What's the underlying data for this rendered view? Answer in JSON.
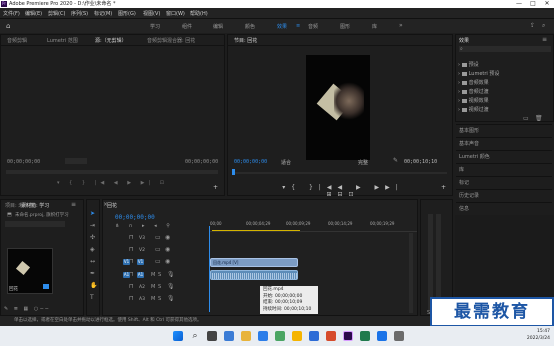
{
  "window": {
    "title": "Adobe Premiere Pro 2020 - D:\\作业\\未命名 *",
    "app_badge": "Pr",
    "controls": [
      "—",
      "□",
      "✕"
    ]
  },
  "menubar": [
    "文件(F)",
    "编辑(E)",
    "剪辑(C)",
    "序列(S)",
    "标记(M)",
    "图形(G)",
    "视图(V)",
    "窗口(W)",
    "帮助(H)"
  ],
  "workspaces": {
    "items": [
      "学习",
      "组件",
      "编辑",
      "颜色",
      "效果",
      "音频",
      "图形",
      "库"
    ],
    "active": "效果"
  },
  "source_panel": {
    "tabs": [
      "音频剪辑",
      "Lumetri 范围",
      "源:（无剪辑）",
      "音频剪辑混合器: 回花"
    ],
    "timecode_left": "00;00;00;00",
    "timecode_right": "00;00;00;00"
  },
  "program_panel": {
    "tab": "节目: 回花",
    "timecode": "00;00;00;00",
    "fit": "适合",
    "quality": "完整",
    "duration": "00;00;10;10"
  },
  "effects_panel": {
    "title": "效果",
    "items": [
      "预设",
      "Lumetri 预设",
      "音频效果",
      "音频过渡",
      "视频效果",
      "视频过渡"
    ],
    "sections": [
      "基本图形",
      "基本声音",
      "Lumetri 颜色",
      "库",
      "标记",
      "历史记录",
      "信息"
    ]
  },
  "project_panel": {
    "tabs": [
      "项目: 未命名",
      "素材箱: 学习"
    ],
    "file": "未命名.prproj, 旗帜打学习",
    "clip_name": "回花"
  },
  "timeline": {
    "tab": "回花",
    "timecode": "00;00;00;00",
    "ruler": [
      "00;00",
      "00;00;04;29",
      "00;00;09;29",
      "00;00;14;29",
      "00;00;19;29"
    ],
    "video_tracks": [
      "V3",
      "V2",
      "V1"
    ],
    "audio_tracks": [
      "A1",
      "A2",
      "A3"
    ],
    "clip_label": "回花.mp4 [V]",
    "tooltip": {
      "name": "回花.mp4",
      "start": "开始: 00;00;00;00",
      "end": "结束: 00;00;10;09",
      "duration": "持续时间: 00;00;10;10"
    }
  },
  "status_bar": "单击以选择，或者在空白处单击并拖动以进行框选。使用 Shift、Alt 和 Ctrl 可获得其他选项。",
  "watermark": "最需教育",
  "taskbar": {
    "time": "15:47",
    "date": "2022/3/24"
  },
  "colors": {
    "accent": "#2d8ceb",
    "video_clip": "#7c9cc4",
    "audio_clip": "#5d8cb8",
    "track_on": "#2e6fb0"
  }
}
